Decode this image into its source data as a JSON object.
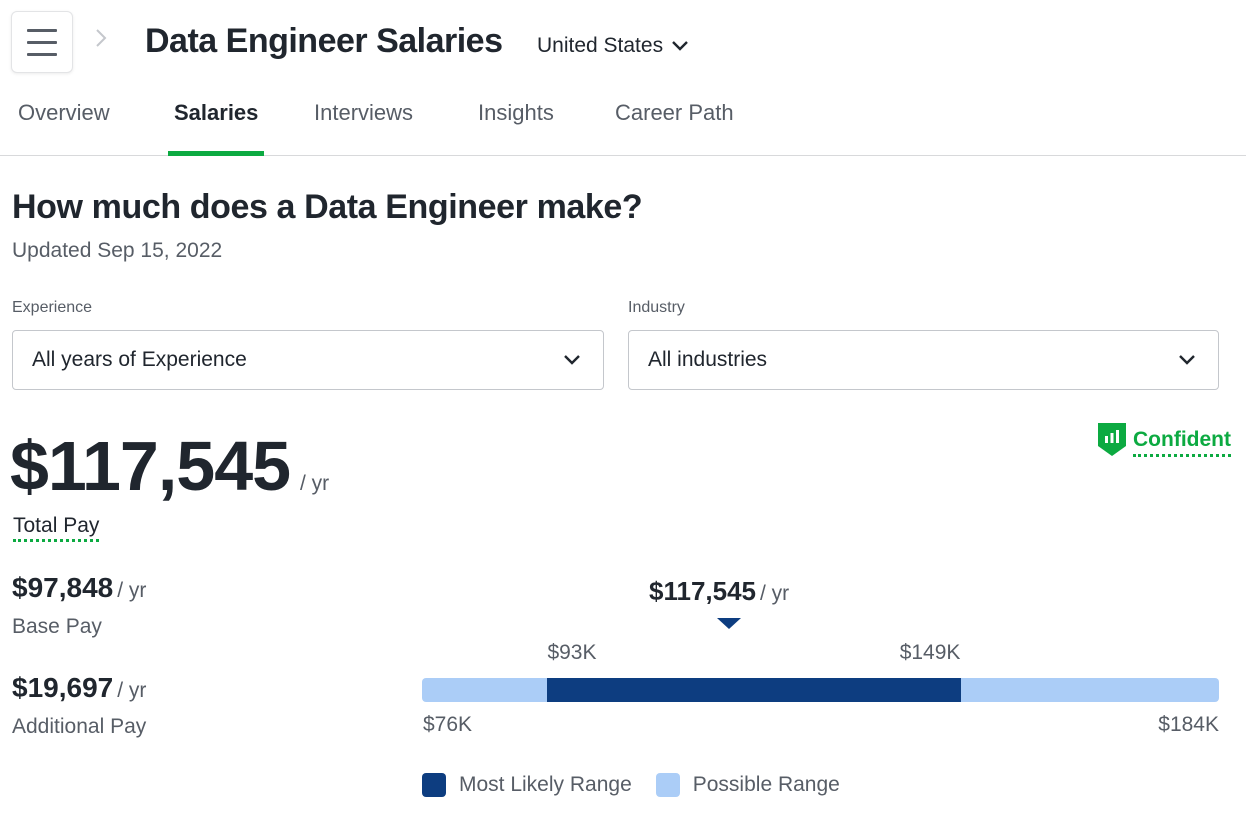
{
  "header": {
    "title": "Data Engineer Salaries",
    "location": "United States"
  },
  "tabs": [
    {
      "label": "Overview",
      "active": false
    },
    {
      "label": "Salaries",
      "active": true
    },
    {
      "label": "Interviews",
      "active": false
    },
    {
      "label": "Insights",
      "active": false
    },
    {
      "label": "Career Path",
      "active": false
    }
  ],
  "section": {
    "title": "How much does a Data Engineer make?",
    "updated": "Updated Sep 15, 2022"
  },
  "filters": {
    "experience": {
      "label": "Experience",
      "value": "All years of Experience"
    },
    "industry": {
      "label": "Industry",
      "value": "All industries"
    }
  },
  "confidence": {
    "label": "Confident",
    "icon": "bar-chart-shield-icon"
  },
  "pay": {
    "total": "$117,545",
    "per_yr": "/ yr",
    "total_label": "Total Pay",
    "base": "$97,848",
    "base_label": "Base Pay",
    "additional": "$19,697",
    "additional_label": "Additional Pay"
  },
  "colors": {
    "accent_green": "#0caa41",
    "most_likely": "#0d3d80",
    "possible": "#abcdf7",
    "text_primary": "#20262e",
    "text_secondary": "#575d66"
  },
  "chart_data": {
    "type": "bar",
    "subtype": "range",
    "marker": {
      "value": 117545,
      "label": "$117,545",
      "unit": "/ yr"
    },
    "possible_range": {
      "min": 76000,
      "max": 184000,
      "min_label": "$76K",
      "max_label": "$184K"
    },
    "most_likely_range": {
      "min": 93000,
      "max": 149000,
      "min_label": "$93K",
      "max_label": "$149K"
    },
    "legend": [
      {
        "name": "Most Likely Range",
        "color": "#0d3d80"
      },
      {
        "name": "Possible Range",
        "color": "#abcdf7"
      }
    ]
  }
}
